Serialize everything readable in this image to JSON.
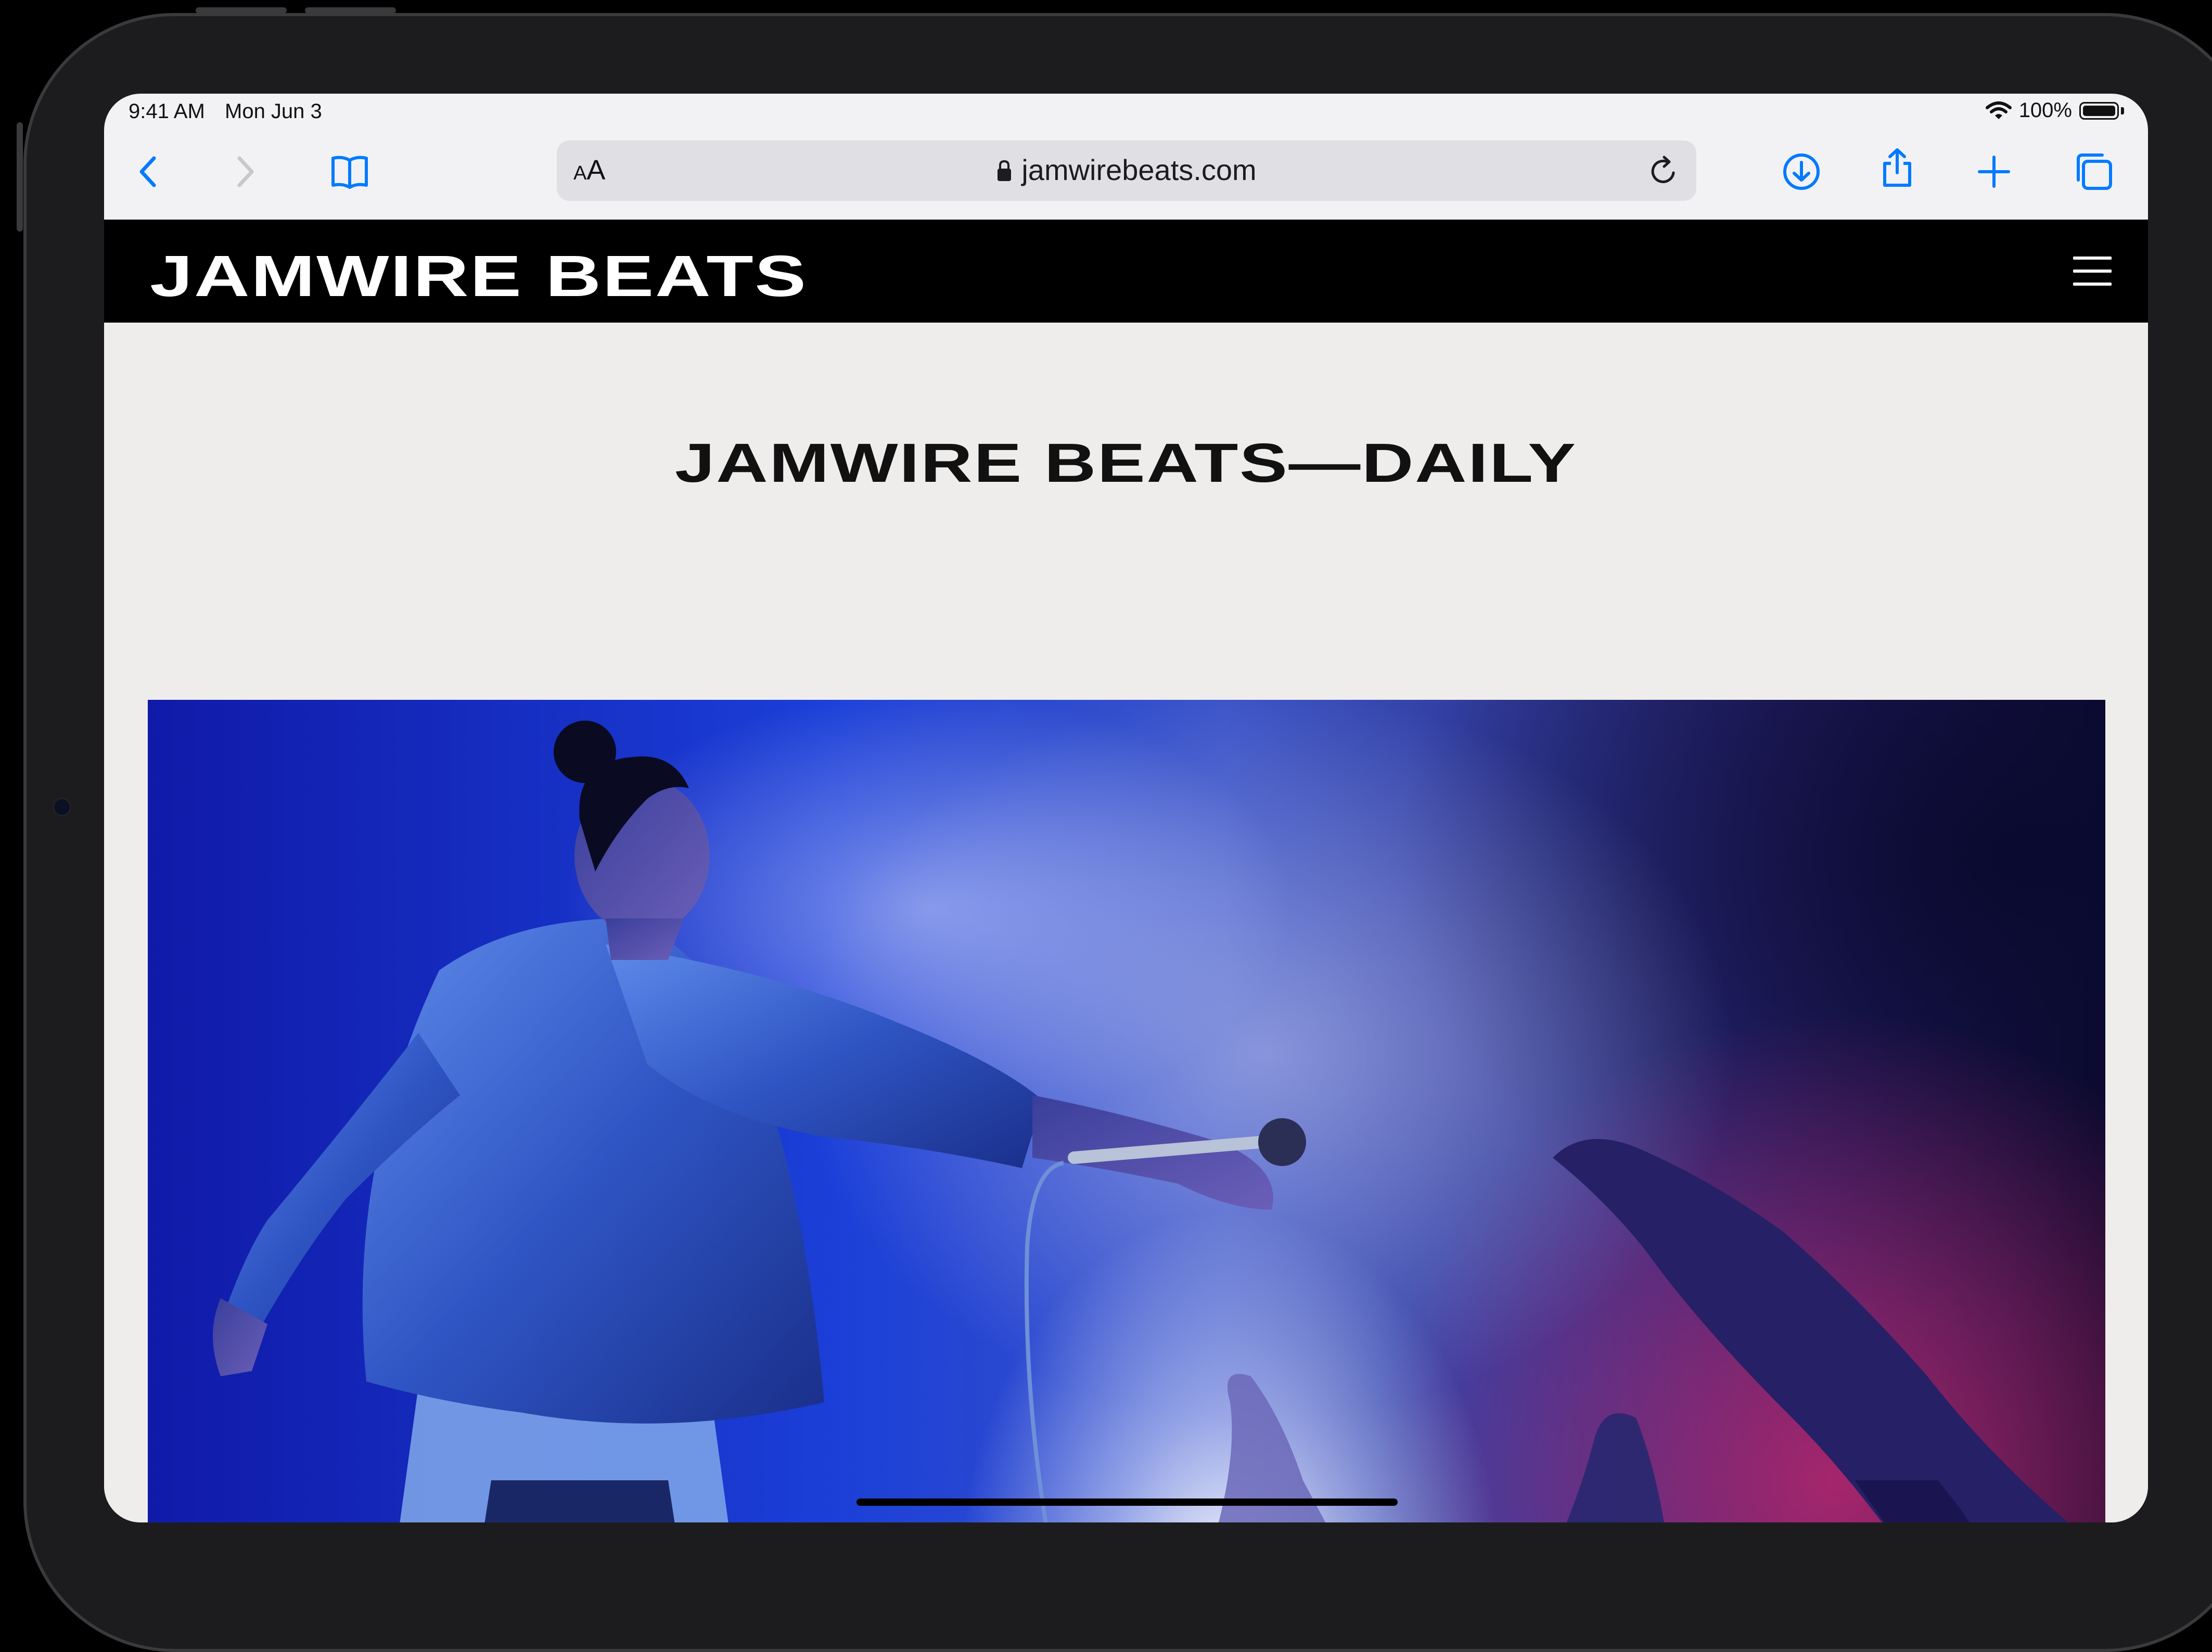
{
  "status_bar": {
    "time": "9:41 AM",
    "date": "Mon Jun 3",
    "battery": "100%",
    "battery_level": 1.0
  },
  "toolbar": {
    "text_size_small": "A",
    "text_size_large": "A",
    "url": "jamwirebeats.com",
    "icons": [
      "back-icon",
      "forward-icon",
      "bookmarks-icon",
      "lock-icon",
      "reload-icon",
      "download-icon",
      "share-icon",
      "new-tab-icon",
      "tabs-icon"
    ]
  },
  "site": {
    "logo": "JAMWIRE BEATS",
    "page_title": "JAMWIRE BEATS—DAILY"
  },
  "colors": {
    "accent": "#007aff",
    "nav_background": "#000000",
    "page_background": "#efedeb"
  }
}
